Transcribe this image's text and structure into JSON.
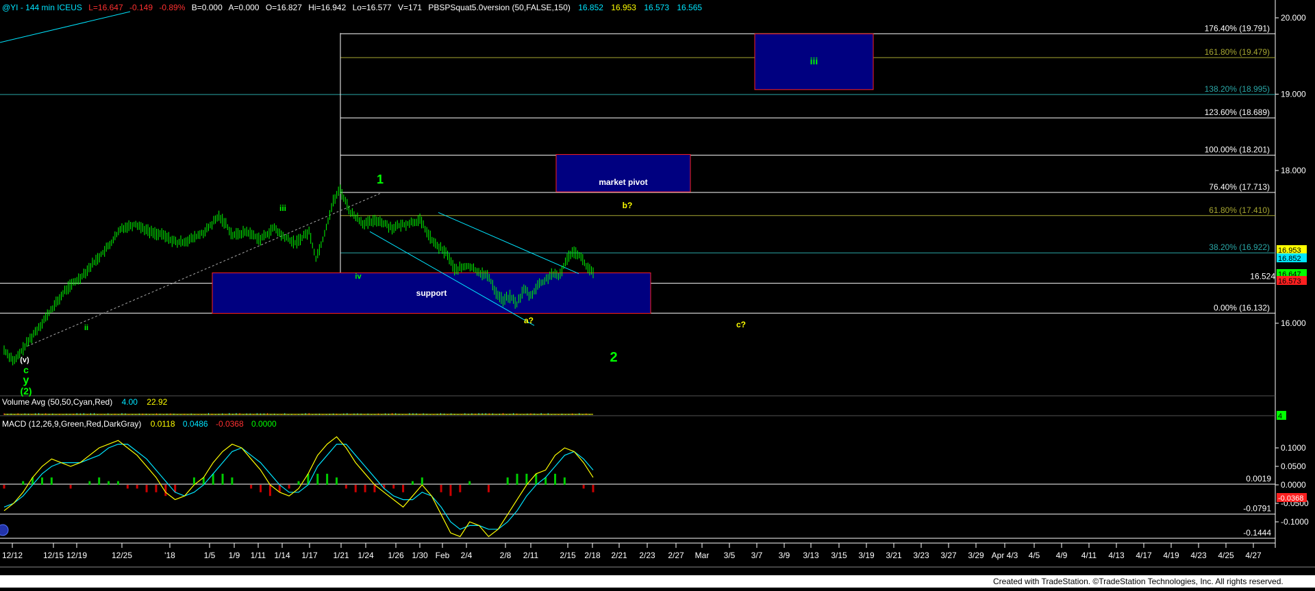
{
  "header": {
    "symbol": "@YI - 144 min ICEUS",
    "last": "L=16.647",
    "change": "-0.149",
    "pct": "-0.89%",
    "bid": "B=0.000",
    "ask": "A=0.000",
    "open": "O=16.827",
    "high": "Hi=16.942",
    "low": "Lo=16.577",
    "vol": "V=171",
    "indicator": "PBSPSquat5.0version (50,FALSE,150)",
    "v1": "16.852",
    "v2": "16.953",
    "v3": "16.573",
    "v4": "16.565"
  },
  "colors": {
    "bg": "#000000",
    "green": "#00ff00",
    "cyan": "#00e5ff",
    "yellow": "#ffff00",
    "blue": "#000080",
    "box_border": "#ff2020",
    "grid": "#ffffff",
    "teal": "#2aa7a7",
    "olive": "#8a8a2a"
  },
  "chart_data": [
    {
      "type": "candlestick",
      "title": "@YI - 144 min ICEUS",
      "ylim": [
        15.0,
        20.1
      ],
      "y_ticks": [
        "20.000",
        "19.000",
        "18.000",
        "16.000"
      ],
      "x_tick_labels": [
        "12/12",
        "12/15",
        "12/19",
        "12/25",
        "'18",
        "1/5",
        "1/9",
        "1/11",
        "1/14",
        "1/17",
        "1/21",
        "1/24",
        "1/26",
        "1/30",
        "Feb",
        "2/4",
        "2/8",
        "2/11",
        "2/15",
        "2/18",
        "2/21",
        "2/23",
        "2/27",
        "Mar",
        "3/5",
        "3/7",
        "3/9",
        "3/13",
        "3/15",
        "3/19",
        "3/21",
        "3/23",
        "3/27",
        "3/29",
        "Apr 4/3",
        "4/5",
        "4/9",
        "4/11",
        "4/13",
        "4/17",
        "4/19",
        "4/23",
        "4/25",
        "4/27"
      ],
      "price_path": [
        [
          0,
          15.65
        ],
        [
          3,
          15.5
        ],
        [
          6,
          15.7
        ],
        [
          10,
          15.95
        ],
        [
          14,
          16.2
        ],
        [
          18,
          16.45
        ],
        [
          22,
          16.6
        ],
        [
          26,
          16.8
        ],
        [
          30,
          17.0
        ],
        [
          34,
          17.25
        ],
        [
          38,
          17.3
        ],
        [
          42,
          17.2
        ],
        [
          46,
          17.15
        ],
        [
          50,
          17.05
        ],
        [
          54,
          17.1
        ],
        [
          58,
          17.2
        ],
        [
          62,
          17.4
        ],
        [
          64,
          17.3
        ],
        [
          66,
          17.15
        ],
        [
          70,
          17.2
        ],
        [
          74,
          17.1
        ],
        [
          78,
          17.25
        ],
        [
          80,
          17.15
        ],
        [
          84,
          17.05
        ],
        [
          88,
          17.2
        ],
        [
          90,
          16.85
        ],
        [
          92,
          17.1
        ],
        [
          95,
          17.6
        ],
        [
          97,
          17.75
        ],
        [
          100,
          17.45
        ],
        [
          104,
          17.3
        ],
        [
          108,
          17.35
        ],
        [
          112,
          17.25
        ],
        [
          116,
          17.3
        ],
        [
          120,
          17.35
        ],
        [
          124,
          17.05
        ],
        [
          128,
          16.9
        ],
        [
          130,
          16.7
        ],
        [
          134,
          16.75
        ],
        [
          138,
          16.65
        ],
        [
          140,
          16.6
        ],
        [
          142,
          16.4
        ],
        [
          144,
          16.3
        ],
        [
          146,
          16.35
        ],
        [
          148,
          16.25
        ],
        [
          150,
          16.45
        ],
        [
          152,
          16.35
        ],
        [
          154,
          16.5
        ],
        [
          156,
          16.55
        ],
        [
          158,
          16.65
        ],
        [
          160,
          16.6
        ],
        [
          162,
          16.8
        ],
        [
          164,
          16.95
        ],
        [
          166,
          16.9
        ],
        [
          168,
          16.75
        ],
        [
          170,
          16.65
        ]
      ],
      "volume_avg": {
        "label": "Volume Avg (50,50,Cyan,Red)",
        "value1": "4.00",
        "value2": "22.92",
        "last_badge": "4"
      },
      "fib_levels": [
        {
          "label": "176.40% (19.791)",
          "price": 19.791,
          "color": "#ffffff"
        },
        {
          "label": "161.80% (19.479)",
          "price": 19.479,
          "color": "#a8a832"
        },
        {
          "label": "138.20% (18.995)",
          "price": 18.995,
          "color": "#2aa7a7"
        },
        {
          "label": "123.60% (18.689)",
          "price": 18.689,
          "color": "#ffffff"
        },
        {
          "label": "100.00% (18.201)",
          "price": 18.201,
          "color": "#ffffff"
        },
        {
          "label": "76.40% (17.713)",
          "price": 17.713,
          "color": "#ffffff"
        },
        {
          "label": "61.80% (17.410)",
          "price": 17.41,
          "color": "#a8a832"
        },
        {
          "label": "38.20% (16.922)",
          "price": 16.922,
          "color": "#2aa7a7"
        },
        {
          "label": "0.00% (16.132)",
          "price": 16.132,
          "color": "#ffffff"
        }
      ],
      "extra_level": {
        "label": "16.524",
        "price": 16.524
      },
      "price_badges": [
        {
          "text": "16.953",
          "bg": "#ffff00",
          "fg": "#000"
        },
        {
          "text": "16.852",
          "bg": "#00e5ff",
          "fg": "#000"
        },
        {
          "text": "16.647",
          "bg": "#00ff00",
          "fg": "#000"
        },
        {
          "text": "16.573",
          "bg": "#ff2020",
          "fg": "#000"
        }
      ],
      "boxes": [
        {
          "label": "support",
          "p_top": 16.66,
          "p_bot": 16.13
        },
        {
          "label": "market pivot",
          "p_top": 18.21,
          "p_bot": 17.72
        },
        {
          "label": "iii",
          "p_top": 19.79,
          "p_bot": 19.06
        }
      ],
      "wave_labels": [
        {
          "text": "1",
          "color": "#00ff00",
          "size": 18
        },
        {
          "text": "iii",
          "color": "#00ff00",
          "size": 12
        },
        {
          "text": "ii",
          "color": "#00ff00",
          "size": 11
        },
        {
          "text": "iv",
          "color": "#00ff00",
          "size": 11
        },
        {
          "text": "b?",
          "color": "#ffff00",
          "size": 12
        },
        {
          "text": "a?",
          "color": "#ffff00",
          "size": 12
        },
        {
          "text": "c?",
          "color": "#ffff00",
          "size": 12
        },
        {
          "text": "2",
          "color": "#00ff00",
          "size": 20
        },
        {
          "text": "(v)",
          "color": "#ffffff",
          "size": 11
        },
        {
          "text": "c",
          "color": "#00ff00",
          "size": 14
        },
        {
          "text": "y",
          "color": "#00ff00",
          "size": 16
        },
        {
          "text": "(2)",
          "color": "#00ff00",
          "size": 14
        }
      ]
    },
    {
      "type": "line",
      "label": "MACD (12,26,9,Green,Red,DarkGray)",
      "values_text": [
        "0.0118",
        "0.0486",
        "-0.0368",
        "0.0000"
      ],
      "ylim": [
        -0.16,
        0.16
      ],
      "y_ticks": [
        "0.1000",
        "0.0500",
        "0.0000",
        "-0.0500",
        "-0.1000"
      ],
      "levels": [
        {
          "label": "0.0019",
          "value": 0.0019
        },
        {
          "label": "-0.0791",
          "value": -0.0791
        },
        {
          "label": "-0.1444",
          "value": -0.1444
        }
      ],
      "last_badge": "-0.0368",
      "macd": [
        -0.07,
        -0.05,
        -0.02,
        0.02,
        0.05,
        0.07,
        0.06,
        0.05,
        0.06,
        0.08,
        0.1,
        0.11,
        0.12,
        0.1,
        0.08,
        0.05,
        0.02,
        -0.02,
        -0.04,
        -0.03,
        0.0,
        0.02,
        0.06,
        0.09,
        0.11,
        0.1,
        0.07,
        0.04,
        0.0,
        -0.02,
        -0.03,
        -0.01,
        0.03,
        0.08,
        0.11,
        0.13,
        0.1,
        0.06,
        0.03,
        0.0,
        -0.02,
        -0.04,
        -0.06,
        -0.03,
        0.0,
        -0.03,
        -0.08,
        -0.13,
        -0.14,
        -0.1,
        -0.11,
        -0.14,
        -0.12,
        -0.08,
        -0.04,
        0.0,
        0.03,
        0.04,
        0.08,
        0.1,
        0.09,
        0.06,
        0.02
      ],
      "signal": [
        -0.06,
        -0.05,
        -0.03,
        0.0,
        0.03,
        0.05,
        0.06,
        0.06,
        0.06,
        0.07,
        0.08,
        0.1,
        0.11,
        0.11,
        0.09,
        0.07,
        0.04,
        0.01,
        -0.02,
        -0.03,
        -0.02,
        0.0,
        0.03,
        0.06,
        0.09,
        0.1,
        0.08,
        0.06,
        0.03,
        0.0,
        -0.02,
        -0.02,
        0.0,
        0.05,
        0.08,
        0.11,
        0.11,
        0.08,
        0.05,
        0.02,
        -0.01,
        -0.03,
        -0.04,
        -0.04,
        -0.02,
        -0.03,
        -0.06,
        -0.1,
        -0.12,
        -0.11,
        -0.11,
        -0.12,
        -0.12,
        -0.1,
        -0.07,
        -0.03,
        0.0,
        0.02,
        0.05,
        0.08,
        0.09,
        0.07,
        0.04
      ],
      "hist": [
        -0.01,
        0.0,
        0.01,
        0.02,
        0.02,
        0.02,
        0.0,
        -0.01,
        0.0,
        0.01,
        0.02,
        0.01,
        0.01,
        -0.01,
        -0.01,
        -0.02,
        -0.02,
        -0.03,
        -0.02,
        0.0,
        0.02,
        0.02,
        0.03,
        0.03,
        0.02,
        0.0,
        -0.01,
        -0.02,
        -0.03,
        -0.02,
        -0.01,
        0.01,
        0.03,
        0.03,
        0.03,
        0.02,
        -0.01,
        -0.02,
        -0.02,
        -0.02,
        -0.01,
        -0.01,
        -0.02,
        0.01,
        0.02,
        0.0,
        -0.02,
        -0.03,
        -0.02,
        0.01,
        0.0,
        -0.02,
        0.0,
        0.02,
        0.03,
        0.03,
        0.03,
        0.02,
        0.03,
        0.02,
        0.0,
        -0.01,
        -0.02
      ]
    }
  ],
  "footer": {
    "credit": "Created with TradeStation. ©TradeStation Technologies, Inc. All rights reserved."
  }
}
